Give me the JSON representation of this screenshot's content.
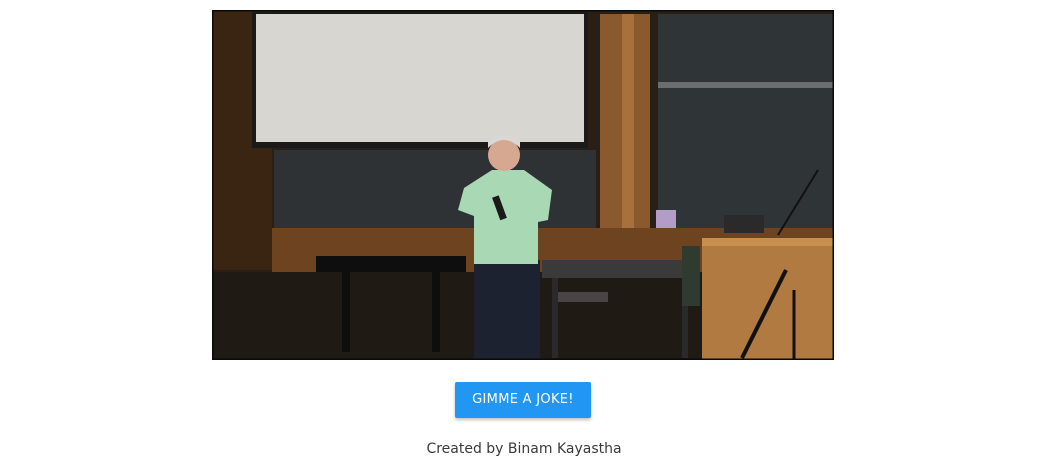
{
  "video": {
    "description_icon": "video-frame-icon"
  },
  "joke_button": {
    "label": "GIMME A JOKE!",
    "color": "#2196f3"
  },
  "footer": {
    "credit": "Created by Binam Kayastha"
  }
}
